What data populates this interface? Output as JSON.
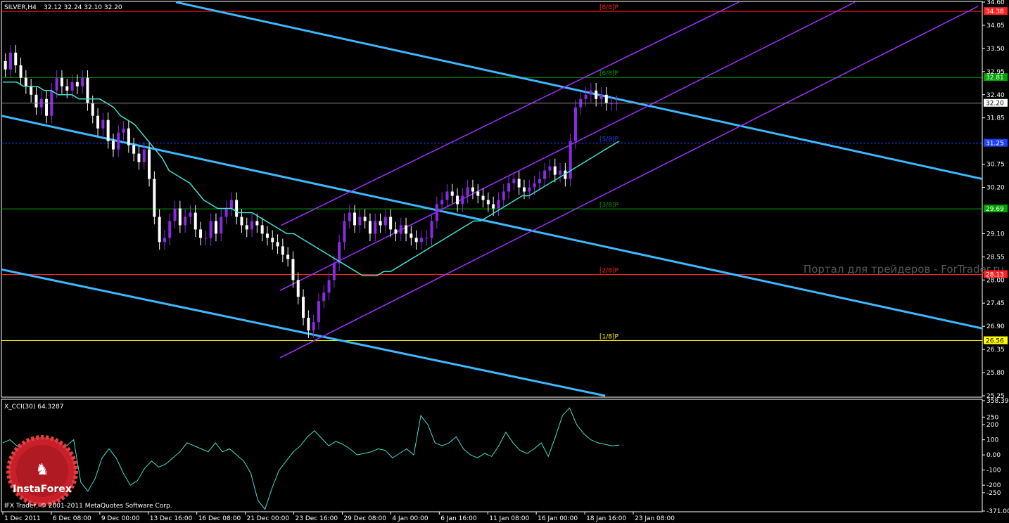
{
  "header": {
    "symbol": "SILVER,H4",
    "ohlc": "32.12 32.24 32.10 32.20"
  },
  "indicator": {
    "title": "X_CCI(30) 64.3287"
  },
  "watermark": "Портал для трейдеров - ForTrader.ru",
  "logo": {
    "text": "InstaForex"
  },
  "copyright": "IFX Trader, © 2001-2011 MetaQuotes Software Corp.",
  "colors": {
    "background": "#000000",
    "candle_up": "#8a2be2",
    "candle_down": "#ffffff",
    "ma": "#40e0d0",
    "channel_blue": "#3fb8ff",
    "channel_violet": "#9b30ff",
    "cci": "#40e0d0"
  },
  "chart_data": [
    {
      "type": "candlestick",
      "ylim": [
        25.25,
        34.6
      ],
      "y_ticks": [
        "34.60",
        "34.05",
        "33.50",
        "32.95",
        "32.40",
        "31.85",
        "30.75",
        "30.20",
        "29.10",
        "28.55",
        "28.00",
        "27.45",
        "26.90",
        "26.35",
        "25.80",
        "25.25"
      ],
      "x_ticks": [
        "1 Dec 2011",
        "6 Dec 08:00",
        "9 Dec 00:00",
        "13 Dec 16:00",
        "16 Dec 08:00",
        "21 Dec 00:00",
        "23 Dec 16:00",
        "29 Dec 08:00",
        "4 Jan 00:00",
        "6 Jan 16:00",
        "11 Jan 08:00",
        "16 Jan 00:00",
        "18 Jan 16:00",
        "23 Jan 08:00"
      ],
      "current_price": {
        "label": "32.20",
        "value": 32.2
      },
      "murrey_levels": [
        {
          "name": "[8/8]P",
          "value": 34.38,
          "label": "34.38",
          "color": "#ff2020"
        },
        {
          "name": "[6/8]P",
          "value": 32.81,
          "label": "32.81",
          "color": "#00a000"
        },
        {
          "name": "[5/8]P",
          "value": 31.25,
          "label": "31.25",
          "color": "#2040ff"
        },
        {
          "name": "[3/8]P",
          "value": 29.69,
          "label": "29.69",
          "color": "#00a000"
        },
        {
          "name": "[2/8]P",
          "value": 28.13,
          "label": "28.13",
          "color": "#ff2020"
        },
        {
          "name": "[1/8]P",
          "value": 26.56,
          "label": "26.56",
          "color": "#ffff00"
        }
      ],
      "close_series": [
        33.0,
        33.4,
        33.1,
        32.8,
        32.6,
        32.4,
        32.1,
        32.3,
        31.9,
        32.5,
        32.8,
        32.6,
        32.5,
        32.7,
        32.6,
        32.8,
        32.2,
        31.9,
        31.6,
        31.8,
        31.3,
        31.1,
        31.5,
        31.6,
        31.2,
        31.0,
        30.8,
        31.1,
        30.4,
        29.5,
        28.9,
        29.0,
        29.4,
        29.7,
        29.3,
        29.5,
        29.6,
        29.2,
        29.0,
        29.0,
        29.4,
        29.1,
        29.5,
        29.7,
        29.9,
        29.5,
        29.3,
        29.2,
        29.4,
        29.3,
        29.1,
        29.0,
        28.9,
        28.8,
        28.6,
        28.5,
        28.0,
        27.6,
        27.1,
        26.8,
        27.0,
        27.5,
        27.7,
        28.0,
        28.4,
        28.9,
        29.4,
        29.6,
        29.3,
        29.5,
        29.4,
        29.1,
        29.4,
        29.3,
        29.5,
        29.2,
        29.1,
        29.3,
        29.1,
        29.0,
        28.9,
        29.0,
        29.0,
        29.4,
        29.8,
        29.9,
        30.1,
        30.0,
        29.8,
        30.0,
        30.2,
        30.1,
        30.0,
        29.9,
        29.8,
        29.7,
        29.9,
        30.1,
        30.3,
        30.4,
        30.2,
        30.1,
        30.2,
        30.3,
        30.4,
        30.6,
        30.7,
        30.5,
        30.6,
        30.4,
        31.3,
        32.1,
        32.3,
        32.4,
        32.5,
        32.3,
        32.4,
        32.2,
        32.2,
        32.2
      ],
      "ma_series": [
        32.7,
        32.7,
        32.7,
        32.6,
        32.6,
        32.6,
        32.5,
        32.5,
        32.4,
        32.4,
        32.4,
        32.3,
        32.3,
        32.3,
        32.3,
        32.2,
        32.1,
        31.9,
        31.8,
        31.7,
        31.5,
        31.3,
        31.1,
        30.9,
        30.6,
        30.5,
        30.4,
        30.3,
        30.1,
        29.9,
        29.8,
        29.7,
        29.7,
        29.7,
        29.6,
        29.6,
        29.6,
        29.5,
        29.4,
        29.3,
        29.2,
        29.1,
        29.1,
        29.0,
        28.9,
        28.8,
        28.7,
        28.6,
        28.5,
        28.4,
        28.3,
        28.2,
        28.1,
        28.1,
        28.1,
        28.2,
        28.2,
        28.3,
        28.4,
        28.5,
        28.6,
        28.7,
        28.8,
        28.9,
        29.0,
        29.1,
        29.2,
        29.3,
        29.4,
        29.4,
        29.5,
        29.6,
        29.7,
        29.8,
        29.9,
        30.0,
        30.0,
        30.1,
        30.2,
        30.3,
        30.4,
        30.5,
        30.6,
        30.7,
        30.8,
        30.9,
        31.0,
        31.1,
        31.2,
        31.3
      ]
    },
    {
      "type": "line",
      "title": "X_CCI(30) 64.3287",
      "ylim": [
        -371.002,
        358.395
      ],
      "y_ticks": [
        "358.395",
        "250",
        "200",
        "100",
        "0.00",
        "-100",
        "-200",
        "-250",
        "-371.002"
      ],
      "values": [
        80,
        100,
        60,
        20,
        -20,
        -80,
        -120,
        -60,
        20,
        60,
        100,
        -180,
        -240,
        -160,
        -20,
        40,
        -20,
        -120,
        -200,
        -170,
        -90,
        -40,
        -80,
        -60,
        -20,
        20,
        80,
        60,
        40,
        20,
        80,
        20,
        40,
        0,
        -40,
        -120,
        -300,
        -360,
        -220,
        -100,
        -40,
        20,
        60,
        120,
        160,
        110,
        60,
        90,
        70,
        40,
        0,
        10,
        20,
        40,
        30,
        -20,
        10,
        40,
        0,
        260,
        200,
        80,
        60,
        80,
        120,
        40,
        0,
        -20,
        10,
        -10,
        60,
        150,
        80,
        30,
        10,
        40,
        80,
        -10,
        120,
        260,
        310,
        200,
        140,
        100,
        80,
        70,
        60,
        64.3
      ]
    }
  ]
}
